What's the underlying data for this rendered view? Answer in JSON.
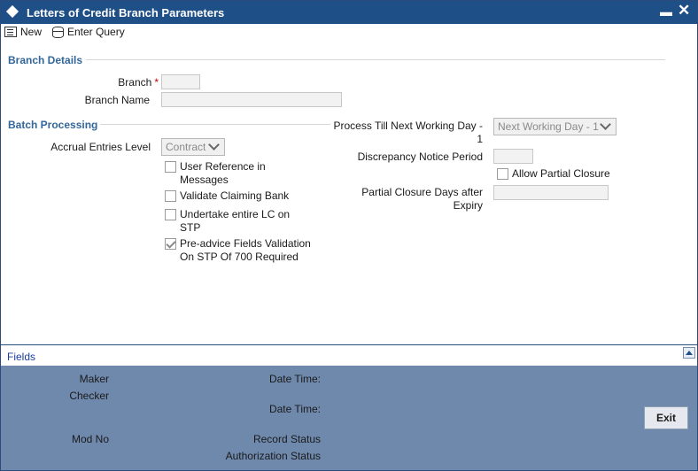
{
  "window": {
    "title": "Letters of Credit Branch Parameters",
    "minimize_label": "▬",
    "close_label": "✕"
  },
  "toolbar": {
    "new_label": "New",
    "enter_query_label": "Enter Query"
  },
  "branch_details": {
    "header": "Branch Details",
    "branch_label": "Branch",
    "required_marker": "*",
    "branch_value": "",
    "branch_name_label": "Branch Name",
    "branch_name_value": ""
  },
  "batch_processing": {
    "header": "Batch Processing",
    "accrual_label": "Accrual Entries Level",
    "accrual_value": "Contract",
    "checkboxes": [
      {
        "label": "User Reference in Messages",
        "checked": false
      },
      {
        "label": "Validate Claiming Bank",
        "checked": false
      },
      {
        "label": "Undertake entire LC on STP",
        "checked": false
      },
      {
        "label": "Pre-advice Fields Validation On STP Of 700 Required",
        "checked": true
      }
    ]
  },
  "right_panel": {
    "process_till_label": "Process Till Next Working Day - 1",
    "process_till_value": "Next Working Day - 1",
    "discrepancy_label": "Discrepancy Notice Period",
    "discrepancy_value": "",
    "allow_partial_closure_label": "Allow Partial Closure",
    "allow_partial_closure_checked": false,
    "partial_closure_days_label": "Partial Closure Days after Expiry",
    "partial_closure_days_value": ""
  },
  "fields_bar": {
    "label": "Fields"
  },
  "footer": {
    "maker_label": "Maker",
    "checker_label": "Checker",
    "date_time_label_1": "Date Time:",
    "date_time_label_2": "Date Time:",
    "mod_no_label": "Mod No",
    "record_status_label": "Record Status",
    "authorization_status_label": "Authorization Status",
    "exit_label": "Exit"
  },
  "colors": {
    "titlebar": "#1f4f87",
    "section_header": "#336699",
    "footer": "#6f89ad",
    "required": "#c00000"
  }
}
